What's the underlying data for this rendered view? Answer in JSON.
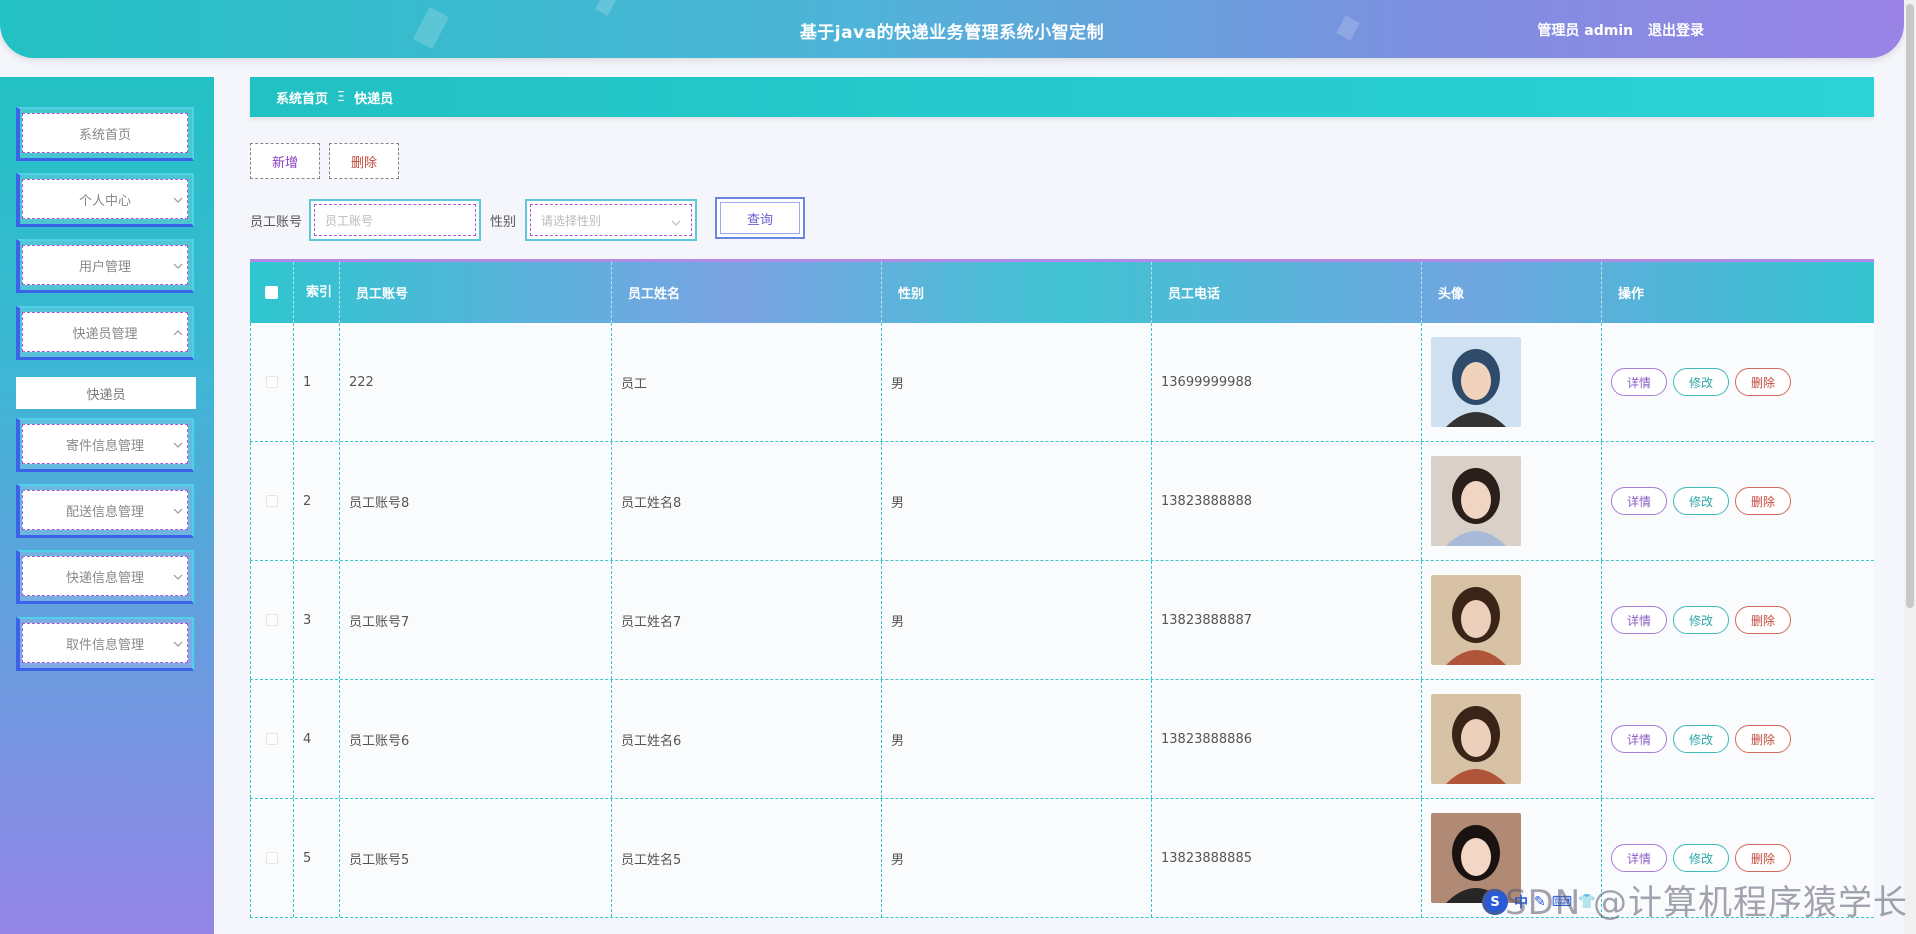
{
  "header": {
    "title": "基于java的快递业务管理系统小智定制",
    "user_label": "管理员 admin",
    "logout_label": "退出登录"
  },
  "sidebar": {
    "items": [
      {
        "label": "系统首页",
        "has_arrow": false
      },
      {
        "label": "个人中心",
        "has_arrow": true,
        "arrow": "down"
      },
      {
        "label": "用户管理",
        "has_arrow": true,
        "arrow": "down"
      },
      {
        "label": "快递员管理",
        "has_arrow": true,
        "arrow": "up"
      },
      {
        "label": "寄件信息管理",
        "has_arrow": true,
        "arrow": "down"
      },
      {
        "label": "配送信息管理",
        "has_arrow": true,
        "arrow": "down"
      },
      {
        "label": "快递信息管理",
        "has_arrow": true,
        "arrow": "down"
      },
      {
        "label": "取件信息管理",
        "has_arrow": true,
        "arrow": "down"
      }
    ],
    "submenu_active": "快递员"
  },
  "breadcrumb": {
    "home": "系统首页",
    "separator": "Ξ",
    "current": "快递员"
  },
  "toolbar": {
    "add_label": "新增",
    "delete_label": "删除"
  },
  "search": {
    "account_label": "员工账号",
    "account_placeholder": "员工账号",
    "gender_label": "性别",
    "gender_placeholder": "请选择性别",
    "query_label": "查询"
  },
  "table": {
    "headers": [
      "索引",
      "员工账号",
      "员工姓名",
      "性别",
      "员工电话",
      "头像",
      "操作"
    ],
    "rows": [
      {
        "index": "1",
        "account": "222",
        "name": "员工",
        "gender": "男",
        "phone": "13699999988",
        "avatar": "avatar-male"
      },
      {
        "index": "2",
        "account": "员工账号8",
        "name": "员工姓名8",
        "gender": "男",
        "phone": "13823888888",
        "avatar": "avatar-female-1"
      },
      {
        "index": "3",
        "account": "员工账号7",
        "name": "员工姓名7",
        "gender": "男",
        "phone": "13823888887",
        "avatar": "avatar-female-2"
      },
      {
        "index": "4",
        "account": "员工账号6",
        "name": "员工姓名6",
        "gender": "男",
        "phone": "13823888886",
        "avatar": "avatar-female-2"
      },
      {
        "index": "5",
        "account": "员工账号5",
        "name": "员工姓名5",
        "gender": "男",
        "phone": "13823888885",
        "avatar": "avatar-female-3"
      }
    ],
    "actions": {
      "detail": "详情",
      "edit": "修改",
      "delete": "删除"
    }
  },
  "overlay": {
    "watermark": "CSDN @计算机程序猿学长",
    "ime_text": "中"
  },
  "colors": {
    "accent_teal": "#22c1c3",
    "accent_purple": "#9a83e6",
    "accent_blue": "#3a63e8",
    "delete_red": "#c24a3c"
  }
}
